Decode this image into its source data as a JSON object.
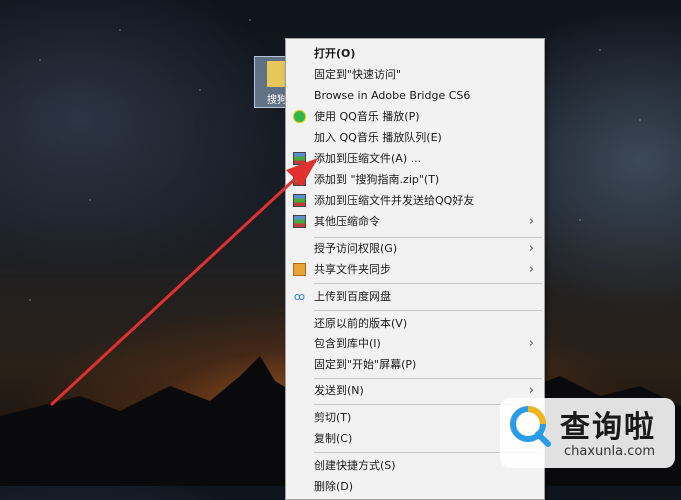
{
  "desktop": {
    "file_label": "搜狗"
  },
  "context_menu": {
    "items": [
      {
        "label": "打开(O)"
      },
      {
        "label": "固定到\"快速访问\""
      },
      {
        "label": "Browse in Adobe Bridge CS6"
      },
      {
        "label": "使用 QQ音乐 播放(P)",
        "icon": "qq-music-icon"
      },
      {
        "label": "加入 QQ音乐 播放队列(E)"
      },
      {
        "label": "添加到压缩文件(A) ...",
        "icon": "winrar-icon"
      },
      {
        "label": "添加到 \"搜狗指南.zip\"(T)",
        "icon": "winrar-icon"
      },
      {
        "label": "添加到压缩文件并发送给QQ好友",
        "icon": "winrar-icon"
      },
      {
        "label": "其他压缩命令",
        "icon": "winrar-icon",
        "submenu": true
      },
      {
        "label": "授予访问权限(G)",
        "submenu": true
      },
      {
        "label": "共享文件夹同步",
        "icon": "share-sync-icon",
        "submenu": true
      },
      {
        "label": "上传到百度网盘",
        "icon": "baidu-netdisk-icon"
      },
      {
        "label": "还原以前的版本(V)"
      },
      {
        "label": "包含到库中(I)",
        "submenu": true
      },
      {
        "label": "固定到\"开始\"屏幕(P)"
      },
      {
        "label": "发送到(N)",
        "submenu": true
      },
      {
        "label": "剪切(T)"
      },
      {
        "label": "复制(C)"
      },
      {
        "label": "创建快捷方式(S)"
      },
      {
        "label": "删除(D)"
      }
    ]
  },
  "watermark": {
    "title": "查询啦",
    "subtitle": "chaxunla.com"
  },
  "colors": {
    "arrow": "#e03030",
    "menu_bg": "#f2f2f2"
  }
}
